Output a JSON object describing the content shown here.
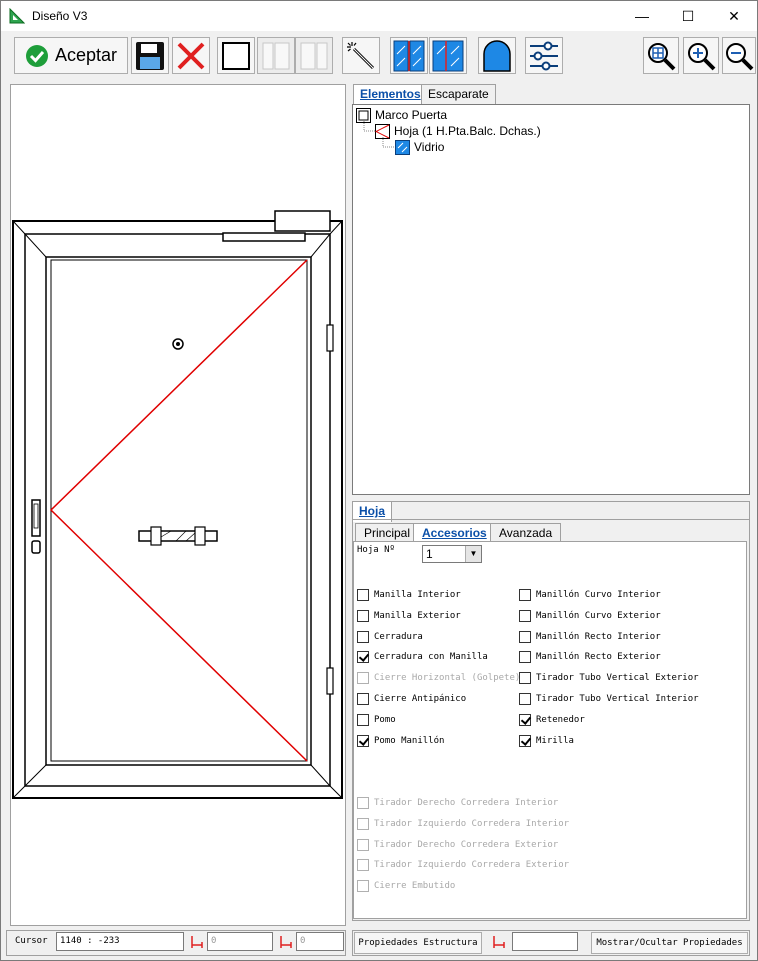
{
  "window": {
    "title": "Diseño V3",
    "minimize": "—",
    "maximize": "☐",
    "close": "✕"
  },
  "toolbar": {
    "accept_label": "Aceptar",
    "tools": [
      "check-icon",
      "save-icon",
      "cancel-icon",
      "frame-icon",
      "split-left-icon",
      "split-right-icon",
      "wand-icon",
      "glass-pair-icon",
      "glass-icon",
      "arch-icon",
      "sliders-icon",
      "zoom-fit-icon",
      "zoom-in-icon",
      "zoom-out-icon"
    ]
  },
  "colors": {
    "accent": "#0a4fa8",
    "check_green": "#1e9e3a",
    "cancel_red": "#e02020",
    "glass_blue": "#1e88e5",
    "diagonal_red": "#e00000"
  },
  "tabs_top": [
    "Elementos",
    "Escaparate"
  ],
  "tree": [
    {
      "label": "Marco Puerta",
      "icon": "frame-icon"
    },
    {
      "label": "Hoja (1 H.Pta.Balc. Dchas.)",
      "icon": "sash-icon"
    },
    {
      "label": "Vidrio",
      "icon": "glass-icon"
    }
  ],
  "panel": {
    "title": "Hoja",
    "subtabs": [
      "Principal",
      "Accesorios",
      "Avanzada"
    ],
    "hoja_label": "Hoja Nº",
    "hoja_value": "1"
  },
  "accessories_left": [
    {
      "label": "Manilla Interior",
      "checked": false,
      "enabled": true
    },
    {
      "label": "Manilla Exterior",
      "checked": false,
      "enabled": true
    },
    {
      "label": "Cerradura",
      "checked": false,
      "enabled": true
    },
    {
      "label": "Cerradura con Manilla",
      "checked": true,
      "enabled": true
    },
    {
      "label": "Cierre Horizontal (Golpete)",
      "checked": false,
      "enabled": false
    },
    {
      "label": "Cierre Antipánico",
      "checked": false,
      "enabled": true
    },
    {
      "label": "Pomo",
      "checked": false,
      "enabled": true
    },
    {
      "label": "Pomo Manillón",
      "checked": true,
      "enabled": true
    }
  ],
  "accessories_right": [
    {
      "label": "Manillón Curvo Interior",
      "checked": false,
      "enabled": true
    },
    {
      "label": "Manillón Curvo Exterior",
      "checked": false,
      "enabled": true
    },
    {
      "label": "Manillón Recto Interior",
      "checked": false,
      "enabled": true
    },
    {
      "label": "Manillón Recto Exterior",
      "checked": false,
      "enabled": true
    },
    {
      "label": "Tirador Tubo Vertical Exterior",
      "checked": false,
      "enabled": true
    },
    {
      "label": "Tirador Tubo Vertical Interior",
      "checked": false,
      "enabled": true
    },
    {
      "label": "Retenedor",
      "checked": true,
      "enabled": true
    },
    {
      "label": "Mirilla",
      "checked": true,
      "enabled": true
    }
  ],
  "accessories_sliding": [
    {
      "label": "Tirador Derecho Corredera Interior",
      "checked": false,
      "enabled": false
    },
    {
      "label": "Tirador Izquierdo Corredera Interior",
      "checked": false,
      "enabled": false
    },
    {
      "label": "Tirador Derecho Corredera Exterior",
      "checked": false,
      "enabled": false
    },
    {
      "label": "Tirador Izquierdo Corredera Exterior",
      "checked": false,
      "enabled": false
    },
    {
      "label": "Cierre Embutido",
      "checked": false,
      "enabled": false
    }
  ],
  "status": {
    "cursor_label": "Cursor",
    "cursor_value": "1140 : -233",
    "measure1": "0",
    "measure2": "0",
    "props_button": "Propiedades Estructura",
    "measure3": "",
    "toggle_button": "Mostrar/Ocultar Propiedades"
  }
}
